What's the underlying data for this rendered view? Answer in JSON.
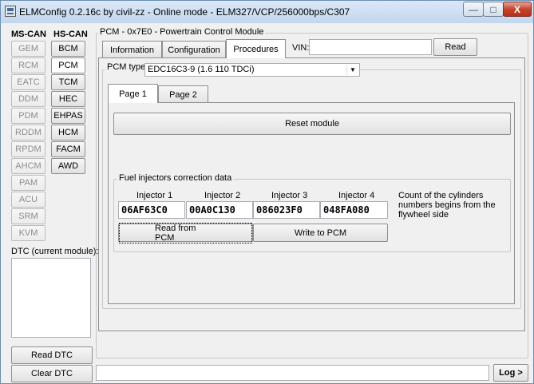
{
  "window": {
    "title": "ELMConfig 0.2.16c by civil-zz - Online mode - ELM327/VCP/256000bps/C307",
    "controls": {
      "minimize": "—",
      "maximize": "□",
      "close": "X"
    }
  },
  "sidebar": {
    "ms_can_header": "MS-CAN",
    "hs_can_header": "HS-CAN",
    "ms_can": [
      "GEM",
      "RCM",
      "EATC",
      "DDM",
      "PDM",
      "RDDM",
      "RPDM",
      "AHCM",
      "PAM",
      "ACU",
      "SRM",
      "KVM"
    ],
    "hs_can": [
      "BCM",
      "PCM",
      "TCM",
      "HEC",
      "EHPAS",
      "HCM",
      "FACM",
      "AWD"
    ],
    "dtc_label": "DTC (current module):",
    "read_dtc": "Read DTC",
    "clear_dtc": "Clear DTC"
  },
  "module": {
    "group_title": "PCM - 0x7E0 - Powertrain Control Module",
    "tabs": [
      "Information",
      "Configuration",
      "Procedures"
    ],
    "active_tab": "Procedures",
    "vin_label": "VIN:",
    "vin_value": "",
    "read_button": "Read"
  },
  "procedures": {
    "pcm_type_label": "PCM type:",
    "pcm_type_value": "EDC16C3-9 (1.6 110 TDCi)",
    "subtabs": [
      "Page 1",
      "Page 2"
    ],
    "reset_button": "Reset module",
    "injectors": {
      "group_title": "Fuel injectors correction data",
      "labels": [
        "Injector 1",
        "Injector 2",
        "Injector 3",
        "Injector 4"
      ],
      "values": [
        "06AF63C0",
        "00A0C130",
        "086023F0",
        "048FA080"
      ],
      "note": "Count of the cylinders numbers begins from the flywheel side",
      "read_button": "Read from PCM",
      "write_button": "Write to PCM"
    }
  },
  "statusbar": {
    "text": "",
    "log_button": "Log >"
  }
}
